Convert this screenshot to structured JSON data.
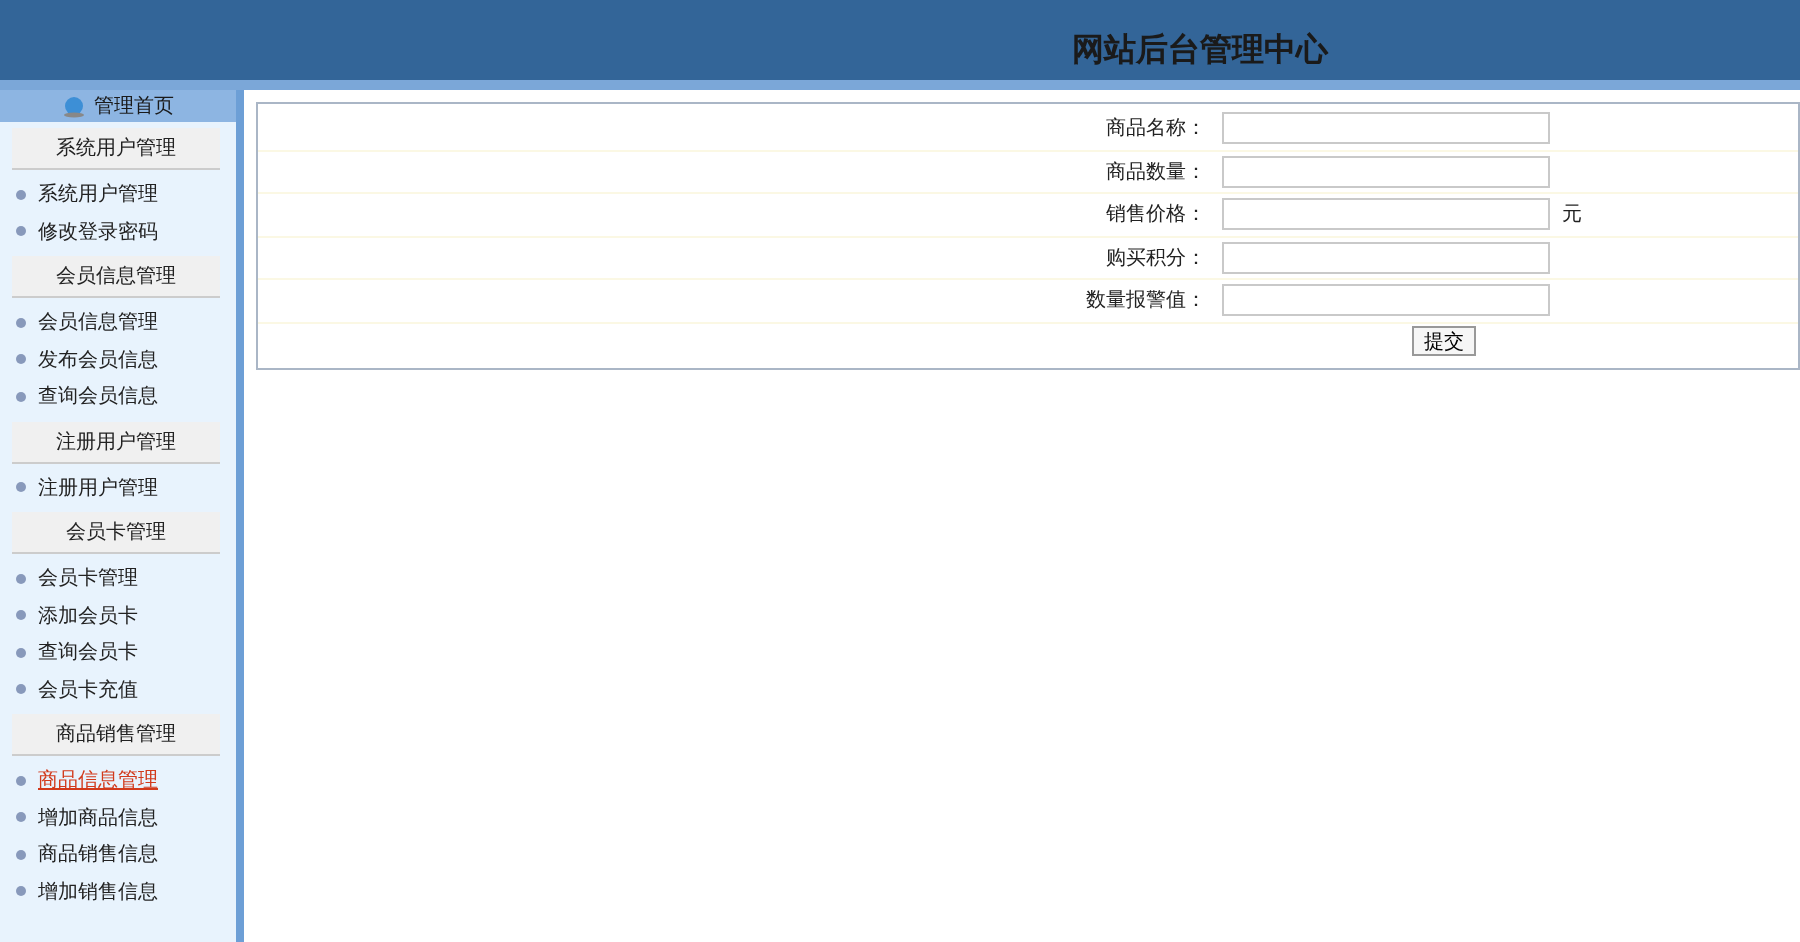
{
  "header": {
    "title": "网站后台管理中心"
  },
  "sidebar": {
    "home": "管理首页",
    "groups": [
      {
        "heading": "系统用户管理",
        "items": [
          {
            "label": "系统用户管理",
            "selected": false
          },
          {
            "label": "修改登录密码",
            "selected": false
          }
        ]
      },
      {
        "heading": "会员信息管理",
        "items": [
          {
            "label": "会员信息管理",
            "selected": false
          },
          {
            "label": "发布会员信息",
            "selected": false
          },
          {
            "label": "查询会员信息",
            "selected": false
          }
        ]
      },
      {
        "heading": "注册用户管理",
        "items": [
          {
            "label": "注册用户管理",
            "selected": false
          }
        ]
      },
      {
        "heading": "会员卡管理",
        "items": [
          {
            "label": "会员卡管理",
            "selected": false
          },
          {
            "label": "添加会员卡",
            "selected": false
          },
          {
            "label": "查询会员卡",
            "selected": false
          },
          {
            "label": "会员卡充值",
            "selected": false
          }
        ]
      },
      {
        "heading": "商品销售管理",
        "items": [
          {
            "label": "商品信息管理",
            "selected": true
          },
          {
            "label": "增加商品信息",
            "selected": false
          },
          {
            "label": "商品销售信息",
            "selected": false
          },
          {
            "label": "增加销售信息",
            "selected": false
          }
        ]
      }
    ]
  },
  "form": {
    "fields": [
      {
        "label": "商品名称："
      },
      {
        "label": "商品数量："
      },
      {
        "label": "销售价格：",
        "unit": "元"
      },
      {
        "label": "购买积分："
      },
      {
        "label": "数量报警值："
      }
    ],
    "submit": "提交"
  }
}
